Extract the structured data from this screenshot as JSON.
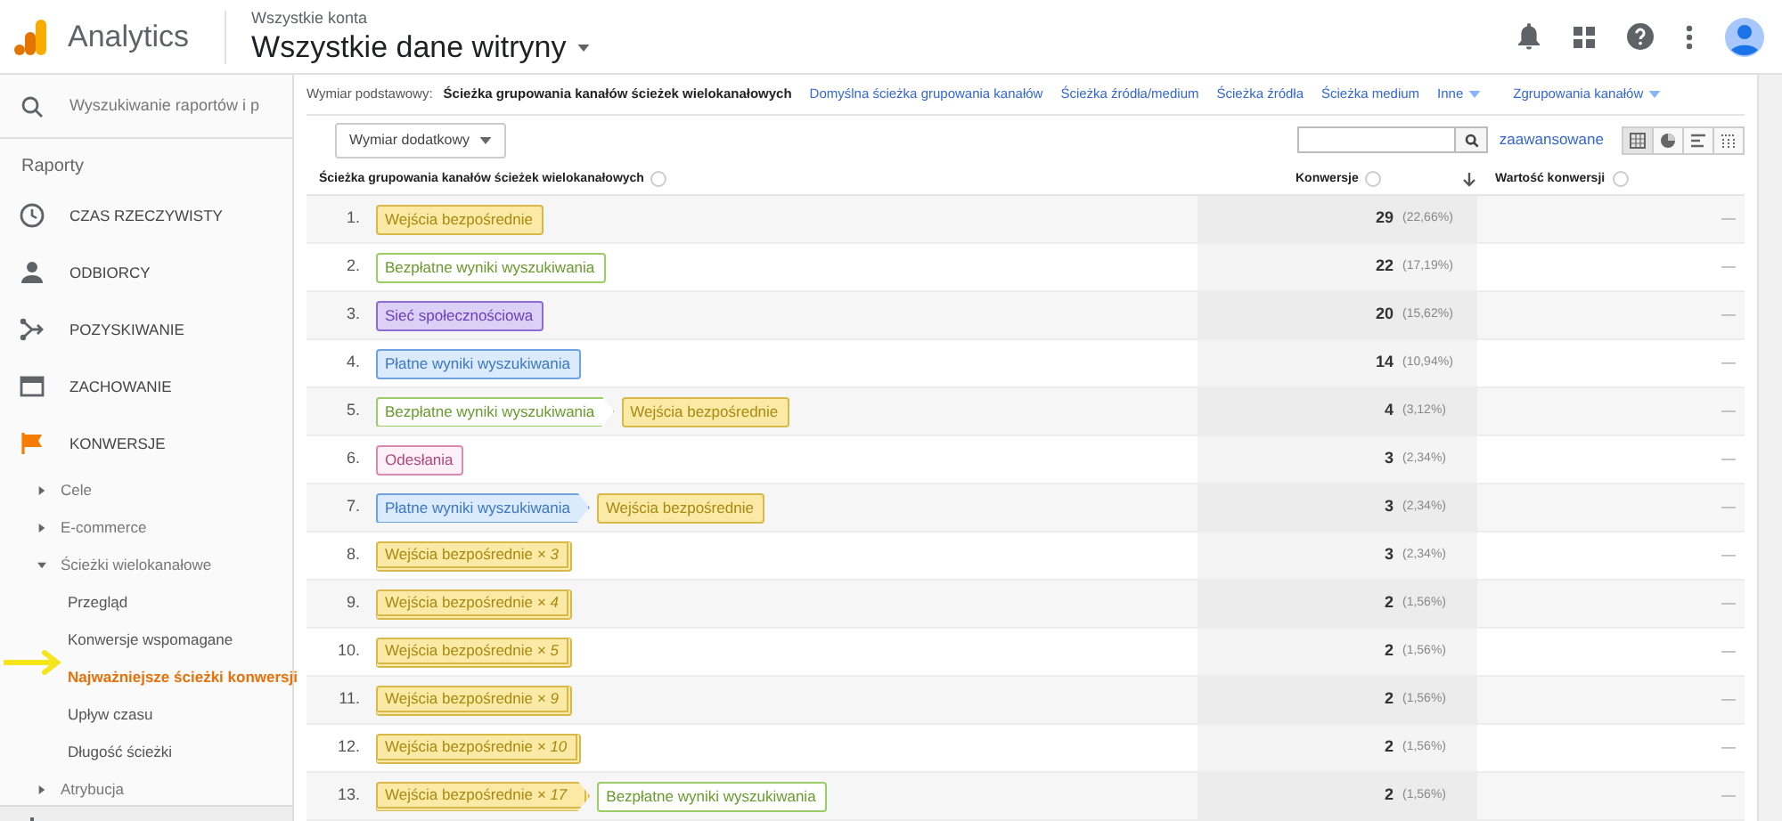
{
  "header": {
    "product": "Analytics",
    "account_label": "Wszystkie konta",
    "property": "Wszystkie dane witryny"
  },
  "sidebar": {
    "search": {
      "placeholder": "Wyszukiwanie raportów i p"
    },
    "section_title": "Raporty",
    "nav": [
      {
        "label": "CZAS RZECZYWISTY",
        "active": false
      },
      {
        "label": "ODBIORCY",
        "active": false
      },
      {
        "label": "POZYSKIWANIE",
        "active": false
      },
      {
        "label": "ZACHOWANIE",
        "active": false
      },
      {
        "label": "KONWERSJE",
        "active": true,
        "children": [
          {
            "label": "Cele",
            "expanded": false
          },
          {
            "label": "E-commerce",
            "expanded": false
          },
          {
            "label": "Ścieżki wielokanałowe",
            "expanded": true,
            "children": [
              {
                "label": "Przegląd",
                "selected": false
              },
              {
                "label": "Konwersje wspomagane",
                "selected": false
              },
              {
                "label": "Najważniejsze ścieżki konwersji",
                "selected": true
              },
              {
                "label": "Upływ czasu",
                "selected": false
              },
              {
                "label": "Długość ścieżki",
                "selected": false
              }
            ]
          },
          {
            "label": "Atrybucja",
            "expanded": false
          }
        ]
      }
    ]
  },
  "dimensions": {
    "label": "Wymiar podstawowy:",
    "options": [
      {
        "label": "Ścieżka grupowania kanałów ścieżek wielokanałowych",
        "selected": true,
        "dropdown": false
      },
      {
        "label": "Domyślna ścieżka grupowania kanałów",
        "selected": false,
        "dropdown": false
      },
      {
        "label": "Ścieżka źródła/medium",
        "selected": false,
        "dropdown": false
      },
      {
        "label": "Ścieżka źródła",
        "selected": false,
        "dropdown": false
      },
      {
        "label": "Ścieżka medium",
        "selected": false,
        "dropdown": false
      },
      {
        "label": "Inne",
        "selected": false,
        "dropdown": true
      },
      {
        "label": "Zgrupowania kanałów",
        "selected": false,
        "dropdown": true
      }
    ]
  },
  "toolbar": {
    "secondary_dimension": "Wymiar dodatkowy",
    "advanced_link": "zaawansowane",
    "views": [
      {
        "selected": true
      },
      {
        "selected": false
      },
      {
        "selected": false
      },
      {
        "selected": false
      }
    ]
  },
  "table": {
    "columns": [
      "Ścieżka grupowania kanałów ścieżek wielokanałowych",
      "Konwersje",
      "Wartość konwersji"
    ],
    "rows": [
      {
        "index": "1.",
        "steps": [
          {
            "kind": "direct",
            "label": "Wejścia bezpośrednie",
            "stacked": false
          }
        ],
        "conversions": "29",
        "share": "(22,66%)",
        "value": "—"
      },
      {
        "index": "2.",
        "steps": [
          {
            "kind": "organic",
            "label": "Bezpłatne wyniki wyszukiwania",
            "stacked": false
          }
        ],
        "conversions": "22",
        "share": "(17,19%)",
        "value": "—"
      },
      {
        "index": "3.",
        "steps": [
          {
            "kind": "social",
            "label": "Sieć społecznościowa",
            "stacked": false
          }
        ],
        "conversions": "20",
        "share": "(15,62%)",
        "value": "—"
      },
      {
        "index": "4.",
        "steps": [
          {
            "kind": "paid",
            "label": "Płatne wyniki wyszukiwania",
            "stacked": false
          }
        ],
        "conversions": "14",
        "share": "(10,94%)",
        "value": "—"
      },
      {
        "index": "5.",
        "steps": [
          {
            "kind": "organic",
            "label": "Bezpłatne wyniki wyszukiwania",
            "stacked": false
          },
          {
            "kind": "direct",
            "label": "Wejścia bezpośrednie",
            "stacked": false
          }
        ],
        "conversions": "4",
        "share": "(3,12%)",
        "value": "—"
      },
      {
        "index": "6.",
        "steps": [
          {
            "kind": "referral",
            "label": "Odesłania",
            "stacked": false
          }
        ],
        "conversions": "3",
        "share": "(2,34%)",
        "value": "—"
      },
      {
        "index": "7.",
        "steps": [
          {
            "kind": "paid",
            "label": "Płatne wyniki wyszukiwania",
            "stacked": false
          },
          {
            "kind": "direct",
            "label": "Wejścia bezpośrednie",
            "stacked": false
          }
        ],
        "conversions": "3",
        "share": "(2,34%)",
        "value": "—"
      },
      {
        "index": "8.",
        "steps": [
          {
            "kind": "direct",
            "label": "Wejścia bezpośrednie *× 3*",
            "stacked": true
          }
        ],
        "conversions": "3",
        "share": "(2,34%)",
        "value": "—"
      },
      {
        "index": "9.",
        "steps": [
          {
            "kind": "direct",
            "label": "Wejścia bezpośrednie *× 4*",
            "stacked": true
          }
        ],
        "conversions": "2",
        "share": "(1,56%)",
        "value": "—"
      },
      {
        "index": "10.",
        "steps": [
          {
            "kind": "direct",
            "label": "Wejścia bezpośrednie *× 5*",
            "stacked": true
          }
        ],
        "conversions": "2",
        "share": "(1,56%)",
        "value": "—"
      },
      {
        "index": "11.",
        "steps": [
          {
            "kind": "direct",
            "label": "Wejścia bezpośrednie *× 9*",
            "stacked": true
          }
        ],
        "conversions": "2",
        "share": "(1,56%)",
        "value": "—"
      },
      {
        "index": "12.",
        "steps": [
          {
            "kind": "direct",
            "label": "Wejścia bezpośrednie *× 10*",
            "stacked": true
          }
        ],
        "conversions": "2",
        "share": "(1,56%)",
        "value": "—"
      },
      {
        "index": "13.",
        "steps": [
          {
            "kind": "direct",
            "label": "Wejścia bezpośrednie *× 17*",
            "stacked": true
          },
          {
            "kind": "organic",
            "label": "Bezpłatne wyniki wyszukiwania",
            "stacked": false
          }
        ],
        "conversions": "2",
        "share": "(1,56%)",
        "value": "—"
      }
    ]
  }
}
